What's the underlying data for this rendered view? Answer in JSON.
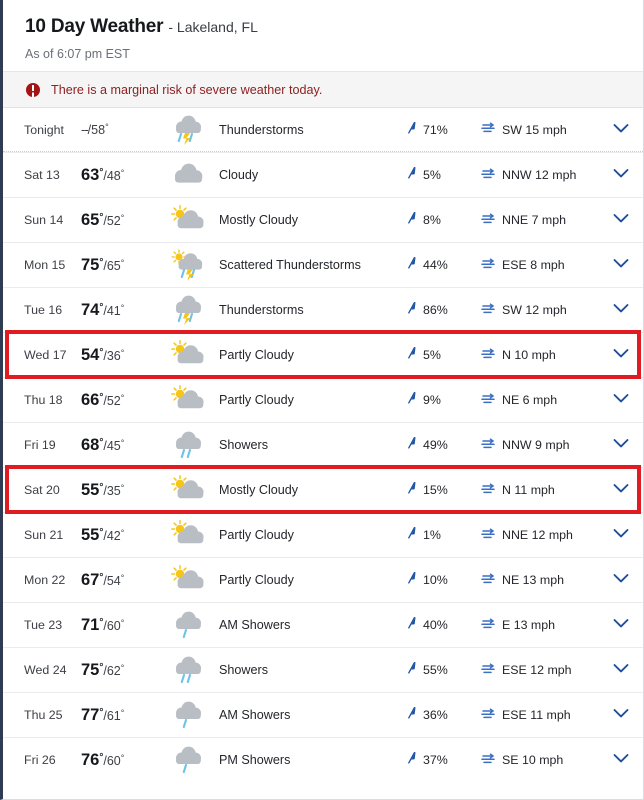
{
  "header": {
    "title": "10 Day Weather",
    "location": "- Lakeland, FL",
    "as_of": "As of 6:07 pm EST"
  },
  "alert": {
    "icon": "alert-exclamation-icon",
    "text": "There is a marginal risk of severe weather today.",
    "color": "#8f2020",
    "background": "#f5f5f5"
  },
  "icons": {
    "precip": "raindrop-icon",
    "wind": "wind-icon",
    "expand": "chevron-down-icon"
  },
  "colors": {
    "highlight": "#e01b22",
    "accent": "#1a4fa0",
    "cloud": "#b9bdc4",
    "sun": "#f5c518",
    "rain": "#6fc3e8"
  },
  "highlight_rows": [
    5,
    8
  ],
  "rows": [
    {
      "day": "Tonight",
      "hi": "--",
      "lo": "58",
      "icon": "thunderstorms",
      "desc": "Thunderstorms",
      "precip": "71%",
      "wind": "SW 15 mph"
    },
    {
      "day": "Sat 13",
      "hi": "63",
      "lo": "48",
      "icon": "cloudy",
      "desc": "Cloudy",
      "precip": "5%",
      "wind": "NNW 12 mph"
    },
    {
      "day": "Sun 14",
      "hi": "65",
      "lo": "52",
      "icon": "mostly-cloudy",
      "desc": "Mostly Cloudy",
      "precip": "8%",
      "wind": "NNE 7 mph"
    },
    {
      "day": "Mon 15",
      "hi": "75",
      "lo": "65",
      "icon": "scattered-thunderstorms",
      "desc": "Scattered Thunderstorms",
      "precip": "44%",
      "wind": "ESE 8 mph"
    },
    {
      "day": "Tue 16",
      "hi": "74",
      "lo": "41",
      "icon": "thunderstorms",
      "desc": "Thunderstorms",
      "precip": "86%",
      "wind": "SW 12 mph"
    },
    {
      "day": "Wed 17",
      "hi": "54",
      "lo": "36",
      "icon": "partly-cloudy",
      "desc": "Partly Cloudy",
      "precip": "5%",
      "wind": "N 10 mph"
    },
    {
      "day": "Thu 18",
      "hi": "66",
      "lo": "52",
      "icon": "partly-cloudy",
      "desc": "Partly Cloudy",
      "precip": "9%",
      "wind": "NE 6 mph"
    },
    {
      "day": "Fri 19",
      "hi": "68",
      "lo": "45",
      "icon": "showers",
      "desc": "Showers",
      "precip": "49%",
      "wind": "NNW 9 mph"
    },
    {
      "day": "Sat 20",
      "hi": "55",
      "lo": "35",
      "icon": "mostly-cloudy",
      "desc": "Mostly Cloudy",
      "precip": "15%",
      "wind": "N 11 mph"
    },
    {
      "day": "Sun 21",
      "hi": "55",
      "lo": "42",
      "icon": "partly-cloudy",
      "desc": "Partly Cloudy",
      "precip": "1%",
      "wind": "NNE 12 mph"
    },
    {
      "day": "Mon 22",
      "hi": "67",
      "lo": "54",
      "icon": "partly-cloudy",
      "desc": "Partly Cloudy",
      "precip": "10%",
      "wind": "NE 13 mph"
    },
    {
      "day": "Tue 23",
      "hi": "71",
      "lo": "60",
      "icon": "am-showers",
      "desc": "AM Showers",
      "precip": "40%",
      "wind": "E 13 mph"
    },
    {
      "day": "Wed 24",
      "hi": "75",
      "lo": "62",
      "icon": "showers",
      "desc": "Showers",
      "precip": "55%",
      "wind": "ESE 12 mph"
    },
    {
      "day": "Thu 25",
      "hi": "77",
      "lo": "61",
      "icon": "am-showers",
      "desc": "AM Showers",
      "precip": "36%",
      "wind": "ESE 11 mph"
    },
    {
      "day": "Fri 26",
      "hi": "76",
      "lo": "60",
      "icon": "pm-showers",
      "desc": "PM Showers",
      "precip": "37%",
      "wind": "SE 10 mph"
    }
  ]
}
